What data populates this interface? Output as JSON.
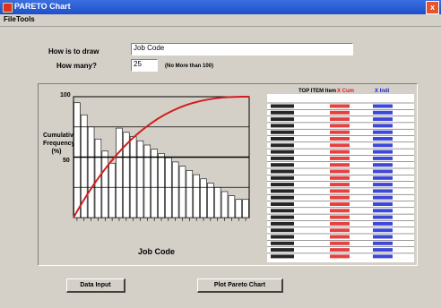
{
  "window": {
    "title": "PARETO Chart",
    "close_glyph": "x",
    "app_icon": "pareto-app-icon"
  },
  "menu": [
    {
      "label": "File"
    },
    {
      "label": "Tools"
    }
  ],
  "form": {
    "what_label": "How is to draw",
    "what_value": "Job Code",
    "how_many_label": "How many?",
    "how_many_value": "25",
    "how_many_hint": "(No More than 100)"
  },
  "chart": {
    "ylabel": "Cumulative Frequency (%)",
    "xlabel": "Job Code",
    "tick_labels": [
      "100",
      "50"
    ],
    "table_header_top": "TOP ITEM Item",
    "table_header_count": "X Cum",
    "table_header_pct": "X Indi"
  },
  "buttons": {
    "input": "Data Input",
    "plot": "Plot Pareto Chart"
  },
  "colors": {
    "titlebar": "#2a5fd8",
    "curve": "#d21e1e",
    "count_col": "#e02020",
    "pct_col": "#1c28d0"
  }
}
